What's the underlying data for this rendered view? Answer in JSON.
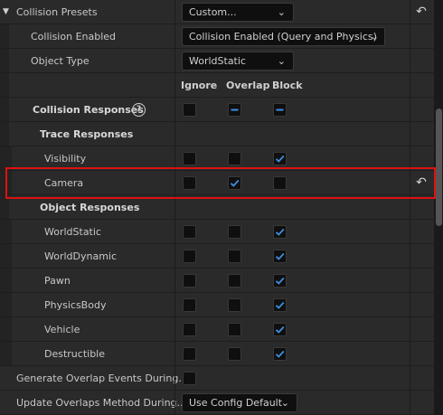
{
  "collision_presets": {
    "label": "Collision Presets",
    "value": "Custom..."
  },
  "collision_enabled": {
    "label": "Collision Enabled",
    "value": "Collision Enabled (Query and Physics)"
  },
  "object_type": {
    "label": "Object Type",
    "value": "WorldStatic"
  },
  "columns": {
    "ignore": "Ignore",
    "overlap": "Overlap",
    "block": "Block"
  },
  "collision_responses": {
    "label": "Collision Responses",
    "help": "?"
  },
  "trace_responses": {
    "label": "Trace Responses"
  },
  "traces": [
    {
      "label": "Visibility",
      "state": "block"
    },
    {
      "label": "Camera",
      "state": "overlap"
    }
  ],
  "object_responses": {
    "label": "Object Responses"
  },
  "objects": [
    {
      "label": "WorldStatic",
      "state": "block"
    },
    {
      "label": "WorldDynamic",
      "state": "block"
    },
    {
      "label": "Pawn",
      "state": "block"
    },
    {
      "label": "PhysicsBody",
      "state": "block"
    },
    {
      "label": "Vehicle",
      "state": "block"
    },
    {
      "label": "Destructible",
      "state": "block"
    }
  ],
  "generate_overlap": {
    "label": "Generate Overlap Events During..."
  },
  "update_overlaps": {
    "label": "Update Overlaps Method During...",
    "value": "Use Config Default"
  },
  "icons": {
    "collapse": "triangle-down-icon",
    "reset": "reset-arrow-icon",
    "chevron": "chevron-down-icon"
  },
  "colors": {
    "check": "#3d8fe0",
    "highlight": "#e01010"
  }
}
